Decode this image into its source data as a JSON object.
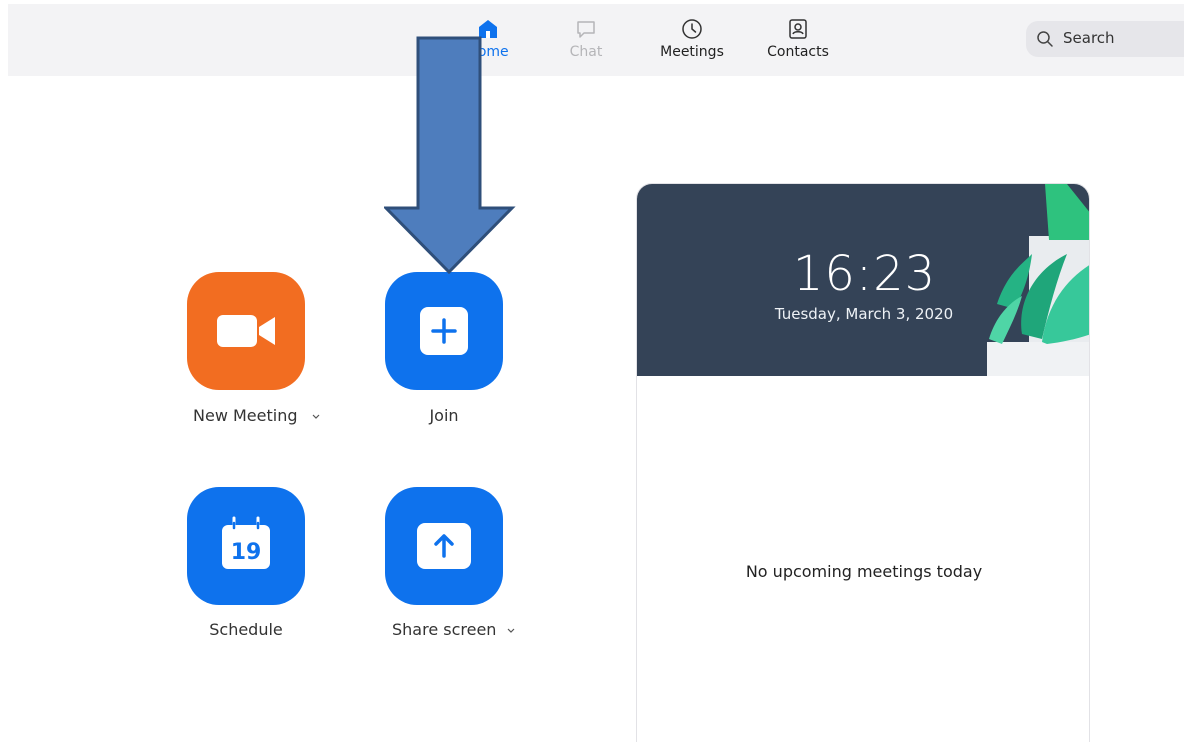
{
  "nav": {
    "tabs": [
      {
        "label": "Home",
        "icon": "home-icon",
        "state": "active"
      },
      {
        "label": "Chat",
        "icon": "chat-icon",
        "state": "disabled"
      },
      {
        "label": "Meetings",
        "icon": "clock-icon",
        "state": "normal"
      },
      {
        "label": "Contacts",
        "icon": "contacts-icon",
        "state": "normal"
      }
    ],
    "search_label": "Search"
  },
  "actions": {
    "new_meeting": {
      "label": "New Meeting",
      "icon": "video-camera-icon"
    },
    "join": {
      "label": "Join",
      "icon": "plus-icon"
    },
    "schedule": {
      "label": "Schedule",
      "icon": "calendar-icon",
      "calendar_day": "19"
    },
    "share_screen": {
      "label": "Share screen",
      "icon": "upload-arrow-icon"
    }
  },
  "calendar_card": {
    "time": "16:23",
    "date": "Tuesday, March 3, 2020",
    "empty_text": "No upcoming meetings today"
  },
  "colors": {
    "accent_blue": "#0e72ed",
    "new_meeting_orange": "#f26d21",
    "card_header": "#344357",
    "annotation_arrow": "#4e7dbd"
  }
}
